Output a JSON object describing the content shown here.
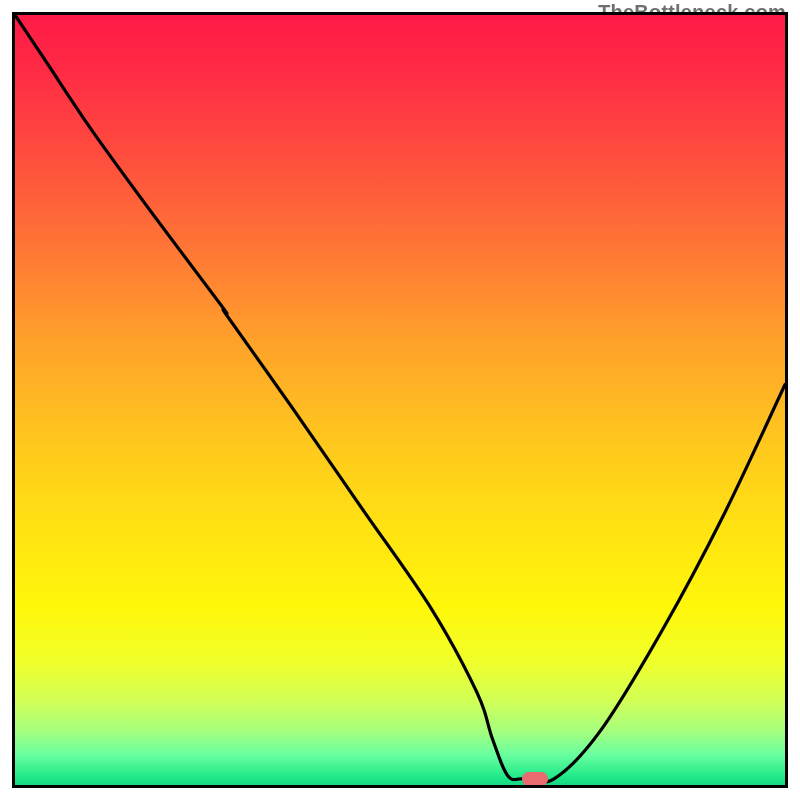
{
  "watermark": "TheBottleneck.com",
  "chart_data": {
    "type": "line",
    "title": "",
    "xlabel": "",
    "ylabel": "",
    "xlim": [
      0,
      100
    ],
    "ylim": [
      0,
      100
    ],
    "x": [
      0,
      4,
      10,
      18,
      27,
      27.5,
      36,
      45,
      54,
      60,
      62,
      64,
      66,
      70,
      76,
      84,
      92,
      100
    ],
    "y": [
      100,
      94,
      85,
      74,
      62,
      61,
      49,
      36,
      23,
      12,
      6,
      1.2,
      0.8,
      0.8,
      7,
      20,
      35,
      52
    ],
    "marker": {
      "x": 67.5,
      "y": 0.8
    },
    "gradient_stops": [
      {
        "pct": 0,
        "color": "#ff1a46"
      },
      {
        "pct": 18,
        "color": "#ff4c3e"
      },
      {
        "pct": 42,
        "color": "#ffa02b"
      },
      {
        "pct": 67,
        "color": "#ffe312"
      },
      {
        "pct": 84,
        "color": "#efff2a"
      },
      {
        "pct": 96,
        "color": "#6aff9f"
      },
      {
        "pct": 100,
        "color": "#15d882"
      }
    ]
  }
}
